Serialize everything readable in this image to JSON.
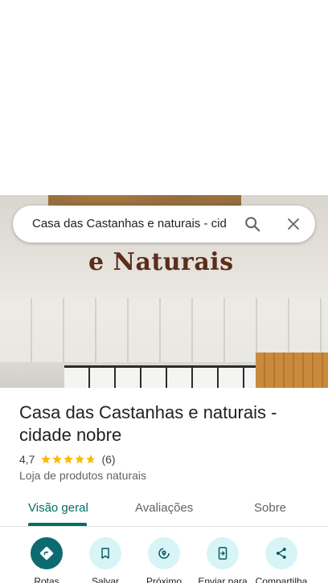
{
  "search": {
    "query": "Casa das Castanhas e naturais - cid"
  },
  "photo": {
    "sign_text": "e Naturais"
  },
  "place": {
    "name": "Casa das Castanhas e naturais - cidade nobre",
    "rating": "4,7",
    "stars": 4.7,
    "review_count": "(6)",
    "category": "Loja de produtos naturais"
  },
  "tabs": [
    {
      "label": "Visão geral",
      "active": true
    },
    {
      "label": "Avaliações",
      "active": false
    },
    {
      "label": "Sobre",
      "active": false
    }
  ],
  "actions": [
    {
      "label": "Rotas",
      "icon": "directions-icon"
    },
    {
      "label": "Salvar",
      "icon": "bookmark-icon"
    },
    {
      "label": "Próximo",
      "icon": "nearby-icon"
    },
    {
      "label": "Enviar para",
      "icon": "send-to-phone-icon"
    },
    {
      "label": "Compartilha",
      "icon": "share-icon"
    }
  ],
  "colors": {
    "accent": "#006e64",
    "action_bg": "#d7f4f6",
    "primary_action": "#0b6b70",
    "star": "#fbbc04"
  }
}
